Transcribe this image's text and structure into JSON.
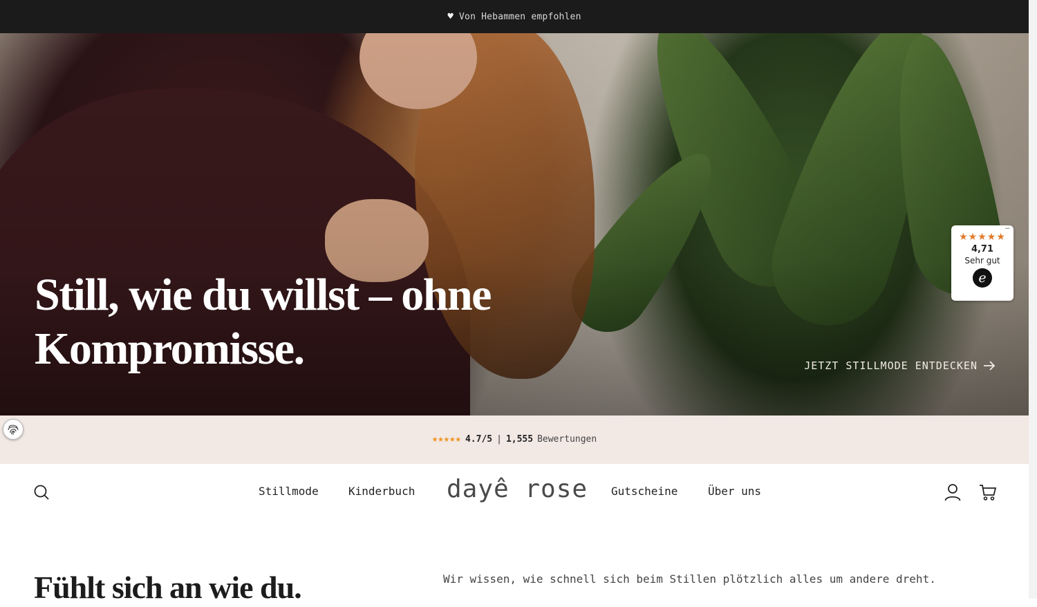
{
  "announcement": {
    "icon": "heart-icon",
    "text": "Von Hebammen empfohlen"
  },
  "hero": {
    "title": "Still, wie du willst – ohne Kompromisse.",
    "cta_label": "JETZT STILLMODE ENTDECKEN",
    "cta_icon": "arrow-right-icon"
  },
  "trust_widget": {
    "stars": "★★★★★",
    "score": "4,71",
    "label": "Sehr gut",
    "logo": "e",
    "menu": "···",
    "accent_color": "#e07b2c"
  },
  "ratings_bar": {
    "stars": "★★★★★",
    "score": "4.7/5",
    "separator": "|",
    "count": "1,555",
    "label": "Bewertungen",
    "star_color": "#f0941f",
    "background": "#f2e8e4"
  },
  "header": {
    "nav_left": [
      "Stillmode",
      "Kinderbuch"
    ],
    "logo": "dayê rose",
    "nav_right": [
      "Gutscheine",
      "Über uns"
    ],
    "icons": [
      "search-icon",
      "account-icon",
      "cart-icon"
    ]
  },
  "intro": {
    "title": "Fühlt sich an wie du.",
    "text": "Wir wissen, wie schnell sich beim Stillen plötzlich alles um andere dreht."
  }
}
